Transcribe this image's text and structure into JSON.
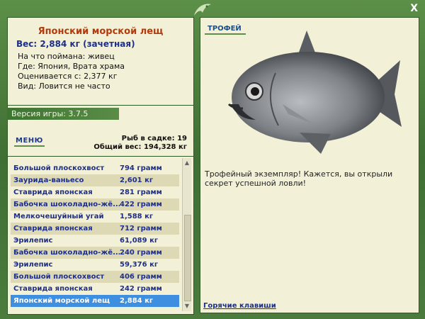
{
  "fish": {
    "name": "Японский морской лещ",
    "weight": "Вес: 2,884 кг (зачетная)",
    "bait": "На что поймана: живец",
    "location": "Где: Япония, Врата храма",
    "value": "Оценивается с: 2,377 кг",
    "frequency": "Вид: Ловится не часто"
  },
  "version": "Версия игры: 3.7.5",
  "menu_label": "МЕНЮ",
  "stats": {
    "count": "Рыб в садке: 19",
    "total": "Общий вес: 194,328 кг"
  },
  "catch_list": [
    {
      "name": "Большой плоскохвост",
      "weight": "794 грамм"
    },
    {
      "name": "Заурида-ваньесо",
      "weight": "2,601 кг"
    },
    {
      "name": "Ставрида японская",
      "weight": "281 грамм"
    },
    {
      "name": "Бабочка шоколадно-жё...",
      "weight": "422 грамм"
    },
    {
      "name": "Мелкочешуйный угай",
      "weight": "1,588 кг"
    },
    {
      "name": "Ставрида японская",
      "weight": "712 грамм"
    },
    {
      "name": "Эрилепис",
      "weight": "61,089 кг"
    },
    {
      "name": "Бабочка шоколадно-жё...",
      "weight": "240 грамм"
    },
    {
      "name": "Эрилепис",
      "weight": "59,376 кг"
    },
    {
      "name": "Большой плоскохвост",
      "weight": "406 грамм"
    },
    {
      "name": "Ставрида японская",
      "weight": "242 грамм"
    },
    {
      "name": "Японский морской лещ",
      "weight": "2,884 кг"
    }
  ],
  "selected_index": 11,
  "trophy": {
    "label": "ТРОФЕЙ",
    "text": "Трофейный экземпляр! Кажется, вы открыли секрет успешной ловли!"
  },
  "hotkeys_label": "Горячие клавиши",
  "close_label": "X",
  "icons": {
    "close": "close-icon",
    "logo": "fish-logo-icon",
    "scroll_up": "arrow-up-icon",
    "scroll_down": "arrow-down-icon"
  },
  "colors": {
    "accent_green": "#4a7a3c",
    "title_red": "#b33a0c",
    "link_blue": "#1e2f8a",
    "selected": "#3f8fe0"
  }
}
